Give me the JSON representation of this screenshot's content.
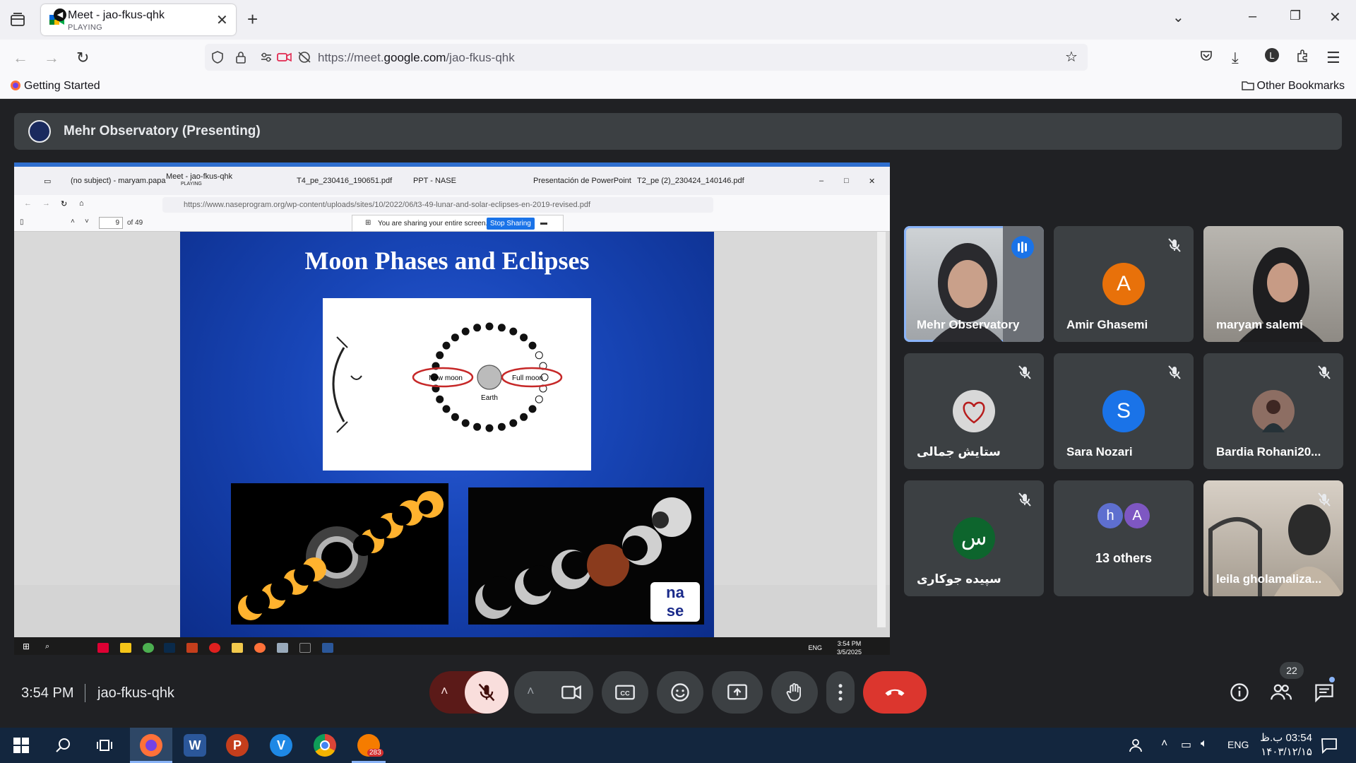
{
  "browser": {
    "tab": {
      "title": "Meet - jao-fkus-qhk",
      "status": "PLAYING"
    },
    "url_prefix": "https://meet.",
    "url_domain": "google.com",
    "url_path": "/jao-fkus-qhk",
    "bookmarks": {
      "getting_started": "Getting Started",
      "other": "Other Bookmarks"
    }
  },
  "meet": {
    "presenting_label": "Mehr Observatory (Presenting)",
    "time": "3:54 PM",
    "meeting_code": "jao-fkus-qhk",
    "people_count": "22",
    "participants": [
      {
        "name": "Mehr Observatory",
        "type": "video",
        "speaking": true
      },
      {
        "name": "Amir Ghasemi",
        "initial": "A",
        "color": "#e8710a",
        "muted": true
      },
      {
        "name": "maryam salemi",
        "type": "video"
      },
      {
        "name": "ستایش جمالی",
        "type": "photo",
        "muted": true
      },
      {
        "name": "Sara Nozari",
        "initial": "S",
        "color": "#1a73e8",
        "muted": true
      },
      {
        "name": "Bardia Rohani20...",
        "type": "photo",
        "muted": true
      },
      {
        "name": "سپیده جوکاری",
        "initial": "س",
        "color": "#0d652d",
        "muted": true
      },
      {
        "name": "13 others",
        "initials": [
          "h",
          "A"
        ],
        "colors": [
          "#5e6fcf",
          "#7e57c2"
        ]
      },
      {
        "name": "leila gholamaliza...",
        "type": "video",
        "muted": true
      }
    ]
  },
  "shared_screen": {
    "tabs": [
      "(no subject) - maryam.papa",
      "Meet - jao-fkus-qhk",
      "PLAYING",
      "T4_pe_230416_190651.pdf",
      "PPT - NASE",
      "Presentación de PowerPoint",
      "T2_pe (2)_230424_140146.pdf"
    ],
    "url_domain": "https://www.naseprogram.org",
    "url_path": "/wp-content/uploads/sites/10/2022/06/t3-49-lunar-and-solar-eclipses-en-2019-revised.pdf",
    "page_number": "9",
    "page_of": "of 49",
    "sharing_message": "You are sharing your entire screen.",
    "stop_sharing": "Stop Sharing",
    "slide_title": "Moon Phases and Eclipses",
    "diagram_labels": {
      "new_moon": "New moon",
      "full_moon": "Full moon",
      "earth": "Earth"
    },
    "logo_text": [
      "na",
      "se"
    ],
    "taskbar_lang": "ENG",
    "taskbar_time": "3:54 PM",
    "taskbar_date": "3/5/2025"
  },
  "taskbar": {
    "lang": "ENG",
    "time": "03:54 ب.ظ",
    "date": "۱۴۰۳/۱۲/۱۵",
    "badge": "283"
  }
}
